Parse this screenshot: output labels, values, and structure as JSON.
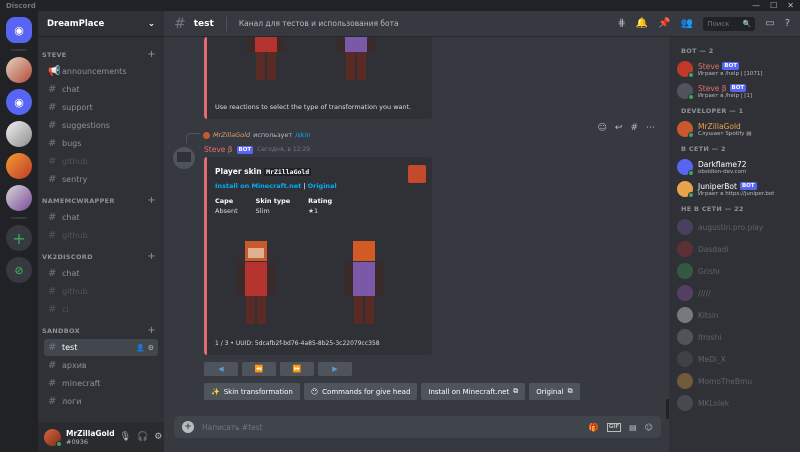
{
  "titlebar": {
    "app": "Discord"
  },
  "guild": {
    "name": "DreamPlace"
  },
  "categories": [
    {
      "name": "STEVE",
      "channels": [
        {
          "name": "announcements",
          "type": "announce",
          "muted": false
        },
        {
          "name": "chat",
          "muted": false
        },
        {
          "name": "support",
          "muted": false
        },
        {
          "name": "suggestions",
          "muted": false
        },
        {
          "name": "bugs",
          "muted": false
        },
        {
          "name": "github",
          "muted": true
        },
        {
          "name": "sentry",
          "muted": false
        }
      ]
    },
    {
      "name": "NAMEMCWRAPPER",
      "channels": [
        {
          "name": "chat",
          "muted": false
        },
        {
          "name": "github",
          "muted": true
        }
      ]
    },
    {
      "name": "VK2DISCORD",
      "channels": [
        {
          "name": "chat",
          "muted": false
        },
        {
          "name": "github",
          "muted": true
        },
        {
          "name": "ci",
          "muted": true
        }
      ]
    },
    {
      "name": "SANDBOX",
      "channels": [
        {
          "name": "test",
          "muted": false,
          "active": true
        },
        {
          "name": "архив",
          "muted": false
        },
        {
          "name": "minecraft",
          "muted": false
        },
        {
          "name": "логи",
          "muted": false
        }
      ]
    }
  ],
  "user": {
    "name": "MrZillaGold",
    "tag": "#0936"
  },
  "header": {
    "channel": "test",
    "topic": "Канал для тестов и использования бота",
    "search_placeholder": "Поиск"
  },
  "embed1": {
    "text": "Use reactions to select the type of transformation you want."
  },
  "reply": {
    "name": "MrZillaGold",
    "verb": "использует",
    "command": "/skin"
  },
  "message": {
    "author": "Steve β",
    "bot_badge": "BOT",
    "time": "Сегодня, в 12:29"
  },
  "embed": {
    "title_prefix": "Player skin",
    "title_code": "MrZillaGold",
    "link1": "Install on Minecraft.net",
    "sep": "|",
    "link2": "Original",
    "fields": [
      {
        "name": "Cape",
        "value": "Absent"
      },
      {
        "name": "Skin type",
        "value": "Slim"
      },
      {
        "name": "Rating",
        "value": "★1"
      }
    ],
    "footer": "1 / 3 • UUID: 5dcafb2f-bd76-4a85-8b25-3c22079cc358"
  },
  "nav_buttons": [
    "◀",
    "⏪",
    "⏩",
    "▶"
  ],
  "action_buttons": [
    {
      "icon": "✨",
      "label": "Skin transformation"
    },
    {
      "icon": "😶",
      "label": "Commands for give head"
    },
    {
      "icon": "",
      "label": "Install on Minecraft.net",
      "ext": "⧉"
    },
    {
      "icon": "",
      "label": "Original",
      "ext": "⧉"
    }
  ],
  "composer": {
    "placeholder": "Написать #test"
  },
  "members": {
    "groups": [
      {
        "title": "BOT — 2",
        "items": [
          {
            "name": "Steve",
            "badge": "BOT",
            "status": "Играет в /help | [1071]",
            "color": "#e36d6d",
            "avatar": "#c0392b"
          },
          {
            "name": "Steve β",
            "badge": "BOT",
            "status": "Играет в /help | [1]",
            "color": "#e36d6d",
            "avatar": "#4f545c"
          }
        ]
      },
      {
        "title": "DEVELOPER — 1",
        "items": [
          {
            "name": "MrZillaGold",
            "badge": "",
            "status": "Слушает Spotify ▤",
            "color": "#e9a34a",
            "avatar": "#c9582e"
          }
        ]
      },
      {
        "title": "В СЕТИ — 2",
        "items": [
          {
            "name": "Darkflame72",
            "badge": "",
            "status": "obsidion-dev.com",
            "color": "#ffffff",
            "avatar": "#5865f2"
          },
          {
            "name": "JuniperBot",
            "badge": "BOT",
            "status": "Играет в https://juniper.bot",
            "color": "#ffffff",
            "avatar": "#e9a34a"
          }
        ]
      },
      {
        "title": "НЕ В СЕТИ — 22",
        "offline": true,
        "items": [
          {
            "name": "augustin.pro.play",
            "avatar": "#7a5aa8"
          },
          {
            "name": "Dasdadi",
            "avatar": "#b4332e"
          },
          {
            "name": "Grishr",
            "avatar": "#3ba55d"
          },
          {
            "name": "/////",
            "avatar": "#9b59b6"
          },
          {
            "name": "Kitsin",
            "avatar": "#ffffff"
          },
          {
            "name": "Itroshi",
            "avatar": "#8e9297"
          },
          {
            "name": "MeDi_X",
            "avatar": "#5b5f66"
          },
          {
            "name": "MomoTheBmu",
            "avatar": "#e9a34a"
          },
          {
            "name": "MKLolek",
            "avatar": "#72767d"
          }
        ]
      }
    ]
  },
  "colors": {
    "accent": "#5865f2",
    "embed_border": "#e36d6d",
    "link": "#00aff4"
  }
}
